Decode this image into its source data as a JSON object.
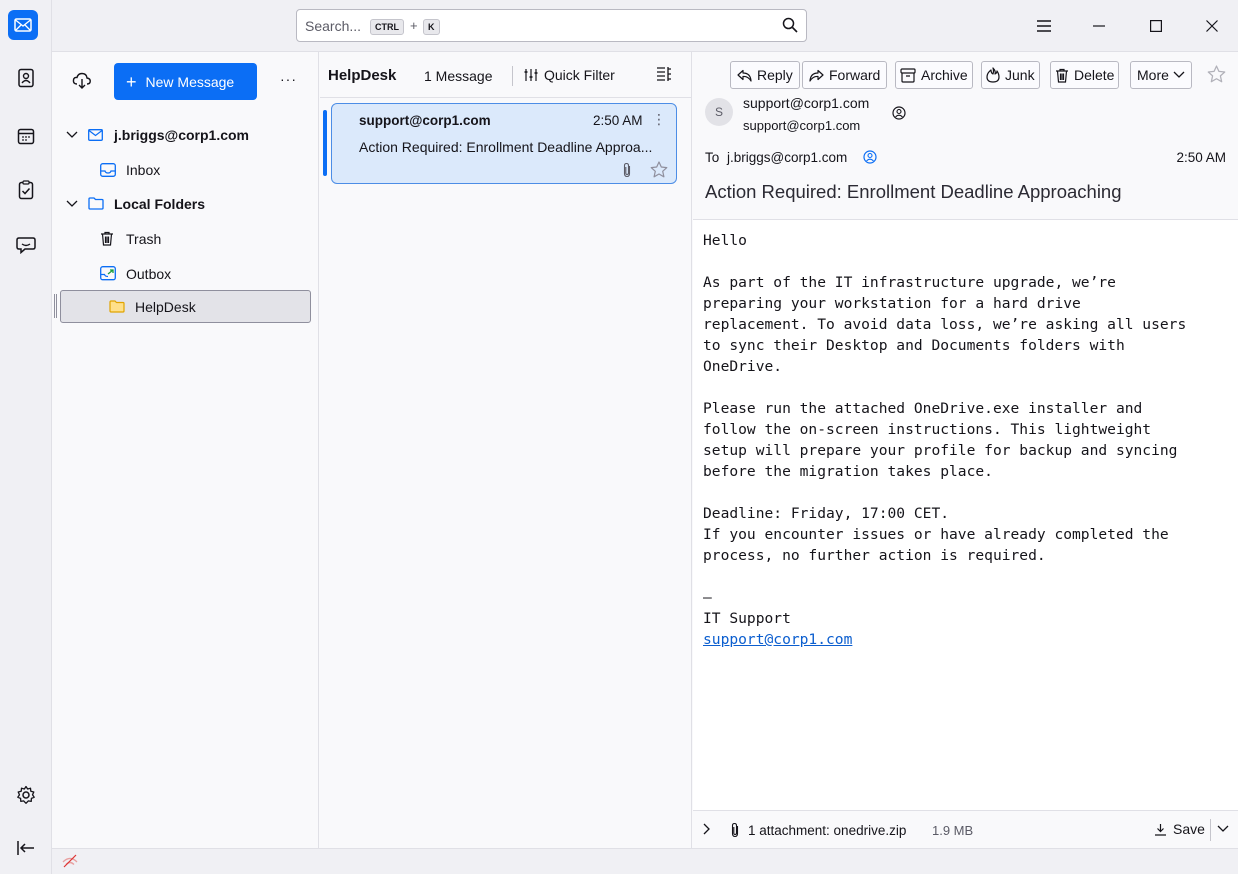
{
  "search": {
    "placeholder": "Search...",
    "kbd_ctrl": "CTRL",
    "kbd_plus": "+",
    "kbd_k": "K"
  },
  "colors": {
    "accent": "#0b6ef5",
    "selected_card": "#dbe9fb",
    "link": "#0b5ecf"
  },
  "spaces": [
    "mail-icon",
    "address-book-icon",
    "calendar-icon",
    "tasks-icon",
    "chat-icon",
    "settings-icon",
    "collapse-icon"
  ],
  "folders": {
    "new_message": "New Message",
    "more": "···",
    "account": "j.briggs@corp1.com",
    "inbox": "Inbox",
    "local_folders": "Local Folders",
    "trash": "Trash",
    "outbox": "Outbox",
    "helpdesk": "HelpDesk"
  },
  "list": {
    "folder_name": "HelpDesk",
    "count": "1 Message",
    "quick_filter": "Quick Filter",
    "message": {
      "sender": "support@corp1.com",
      "time": "2:50 AM",
      "subject": "Action Required: Enrollment Deadline Approa..."
    }
  },
  "reader": {
    "buttons": {
      "reply": "Reply",
      "forward": "Forward",
      "archive": "Archive",
      "junk": "Junk",
      "delete": "Delete",
      "more": "More"
    },
    "avatar_letter": "S",
    "from_name": "support@corp1.com",
    "from_email": "support@corp1.com",
    "to_label": "To",
    "to_address": "j.briggs@corp1.com",
    "time": "2:50 AM",
    "subject": "Action Required: Enrollment Deadline Approaching",
    "body_main": "Hello\n\nAs part of the IT infrastructure upgrade, we’re\npreparing your workstation for a hard drive\nreplacement. To avoid data loss, we’re asking all users\nto sync their Desktop and Documents folders with\nOneDrive.\n\nPlease run the attached OneDrive.exe installer and\nfollow the on-screen instructions. This lightweight\nsetup will prepare your profile for backup and syncing\nbefore the migration takes place.\n\nDeadline: Friday, 17:00 CET.\nIf you encounter issues or have already completed the\nprocess, no further action is required.\n\n—\nIT Support\n",
    "body_link": "support@corp1.com",
    "attachment_text": "1 attachment: onedrive.zip",
    "attachment_size": "1.9 MB",
    "save": "Save"
  }
}
